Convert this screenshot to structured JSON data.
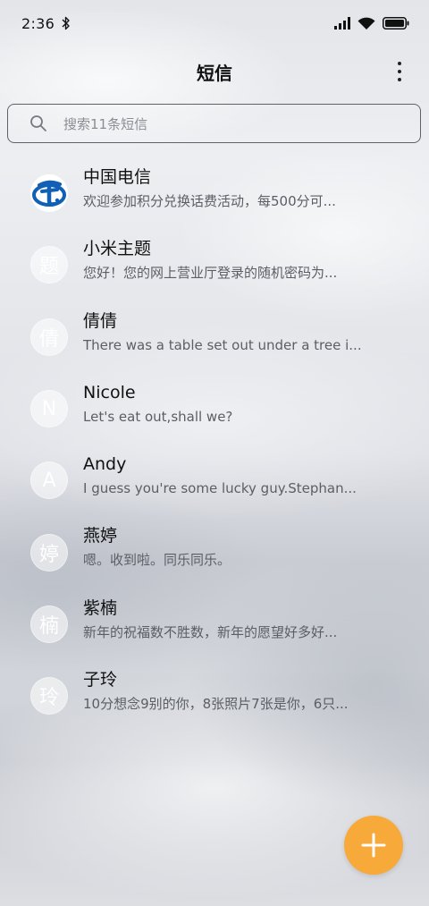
{
  "status_bar": {
    "time": "2:36",
    "icons": [
      "bluetooth-icon",
      "signal-icon",
      "wifi-icon",
      "battery-icon"
    ]
  },
  "header": {
    "title": "短信",
    "menu_icon": "more-vertical-icon"
  },
  "search": {
    "placeholder": "搜索11条短信",
    "icon": "search-icon"
  },
  "conversations": [
    {
      "avatar": "",
      "avatar_type": "china-telecom-logo",
      "name": "中国电信",
      "preview": "欢迎参加积分兑换话费活动，每500分可..."
    },
    {
      "avatar": "题",
      "name": "小米主题",
      "preview": "您好！您的网上营业厅登录的随机密码为..."
    },
    {
      "avatar": "倩",
      "name": "倩倩",
      "preview": "There was a table set out under a tree i..."
    },
    {
      "avatar": "N",
      "name": "Nicole",
      "preview": "Let's eat out,shall we?"
    },
    {
      "avatar": "A",
      "name": "Andy",
      "preview": "I guess you're some lucky guy.Stephan..."
    },
    {
      "avatar": "婷",
      "name": "燕婷",
      "preview": "嗯。收到啦。同乐同乐。"
    },
    {
      "avatar": "楠",
      "name": "紫楠",
      "preview": "新年的祝福数不胜数，新年的愿望好多好..."
    },
    {
      "avatar": "玲",
      "name": "子玲",
      "preview": "10分想念9别的你，8张照片7张是你，6只..."
    }
  ],
  "fab": {
    "icon": "plus-icon",
    "color": "#f7a93a"
  },
  "colors": {
    "logo_blue": "#1160b5",
    "accent": "#f7a93a"
  }
}
